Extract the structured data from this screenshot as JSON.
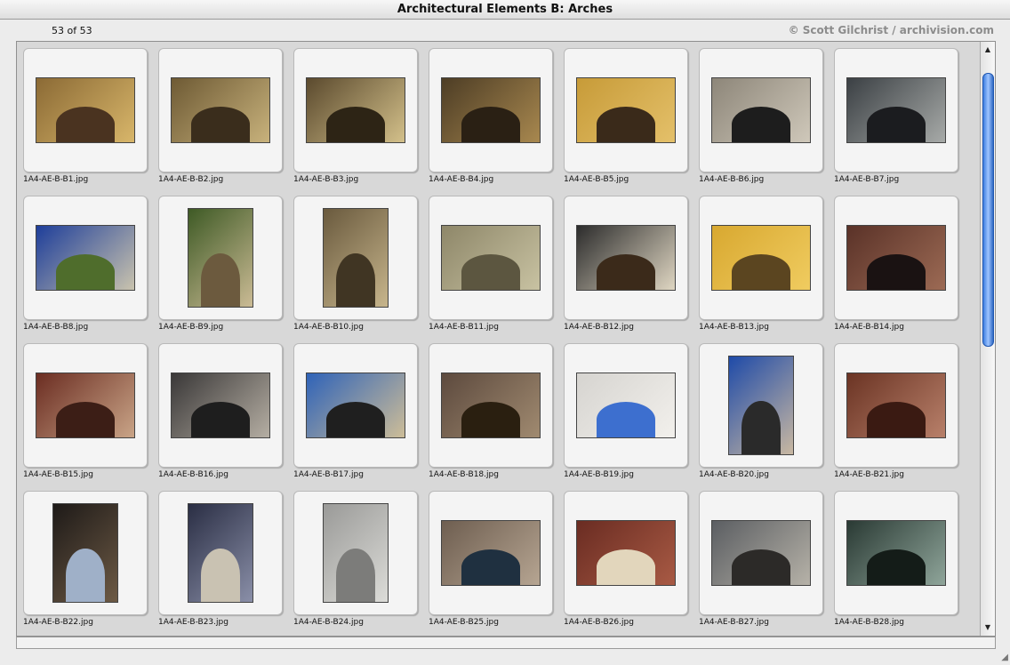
{
  "window": {
    "title": "Architectural Elements B: Arches",
    "counter": "53 of 53",
    "copyright": "© Scott Gilchrist / archivision.com"
  },
  "grid": {
    "items": [
      {
        "label": "1A4-AE-B-B1.jpg",
        "w": 110,
        "h": 72,
        "c1": "#8b6a35",
        "c2": "#d8b66a",
        "arch": "#4a3320"
      },
      {
        "label": "1A4-AE-B-B2.jpg",
        "w": 110,
        "h": 72,
        "c1": "#6e5a34",
        "c2": "#c8b27c",
        "arch": "#3a2d1c"
      },
      {
        "label": "1A4-AE-B-B3.jpg",
        "w": 110,
        "h": 72,
        "c1": "#5b4a2e",
        "c2": "#d3c08a",
        "arch": "#2d2415"
      },
      {
        "label": "1A4-AE-B-B4.jpg",
        "w": 110,
        "h": 72,
        "c1": "#4d3d25",
        "c2": "#a8884f",
        "arch": "#2a2014"
      },
      {
        "label": "1A4-AE-B-B5.jpg",
        "w": 110,
        "h": 72,
        "c1": "#c79b38",
        "c2": "#e4c06a",
        "arch": "#3a2a1a"
      },
      {
        "label": "1A4-AE-B-B6.jpg",
        "w": 110,
        "h": 72,
        "c1": "#8d8679",
        "c2": "#cfc8ba",
        "arch": "#1d1d1d"
      },
      {
        "label": "1A4-AE-B-B7.jpg",
        "w": 110,
        "h": 72,
        "c1": "#3b4044",
        "c2": "#a7aaa8",
        "arch": "#1b1c1f"
      },
      {
        "label": "1A4-AE-B-B8.jpg",
        "w": 110,
        "h": 72,
        "c1": "#1e3e9a",
        "c2": "#c9c3ae",
        "arch": "#4f6d2c"
      },
      {
        "label": "1A4-AE-B-B9.jpg",
        "w": 72,
        "h": 110,
        "c1": "#3e5a25",
        "c2": "#cbbb95",
        "arch": "#6c5a3e"
      },
      {
        "label": "1A4-AE-B-B10.jpg",
        "w": 72,
        "h": 110,
        "c1": "#6a5a3e",
        "c2": "#c7b58c",
        "arch": "#403523"
      },
      {
        "label": "1A4-AE-B-B11.jpg",
        "w": 110,
        "h": 72,
        "c1": "#8e8769",
        "c2": "#c8c2a2",
        "arch": "#5c5640"
      },
      {
        "label": "1A4-AE-B-B12.jpg",
        "w": 110,
        "h": 72,
        "c1": "#2c2c2c",
        "c2": "#dfd6c2",
        "arch": "#3b2a1a"
      },
      {
        "label": "1A4-AE-B-B13.jpg",
        "w": 110,
        "h": 72,
        "c1": "#d8a830",
        "c2": "#f0cc60",
        "arch": "#5b4520"
      },
      {
        "label": "1A4-AE-B-B14.jpg",
        "w": 110,
        "h": 72,
        "c1": "#5a3228",
        "c2": "#9c6a54",
        "arch": "#1a1212"
      },
      {
        "label": "1A4-AE-B-B15.jpg",
        "w": 110,
        "h": 72,
        "c1": "#6b2d22",
        "c2": "#c9a487",
        "arch": "#3c1e16"
      },
      {
        "label": "1A4-AE-B-B16.jpg",
        "w": 110,
        "h": 72,
        "c1": "#3a3838",
        "c2": "#b5aea3",
        "arch": "#1e1e1e"
      },
      {
        "label": "1A4-AE-B-B17.jpg",
        "w": 110,
        "h": 72,
        "c1": "#2f63b8",
        "c2": "#cdbd98",
        "arch": "#1f1f1f"
      },
      {
        "label": "1A4-AE-B-B18.jpg",
        "w": 110,
        "h": 72,
        "c1": "#5d4a3e",
        "c2": "#a08a70",
        "arch": "#2a1f10"
      },
      {
        "label": "1A4-AE-B-B19.jpg",
        "w": 110,
        "h": 72,
        "c1": "#d6d4d0",
        "c2": "#f2f0ec",
        "arch": "#3d6fcf"
      },
      {
        "label": "1A4-AE-B-B20.jpg",
        "w": 72,
        "h": 110,
        "c1": "#1e4aa8",
        "c2": "#c9b8a2",
        "arch": "#2a2a2a"
      },
      {
        "label": "1A4-AE-B-B21.jpg",
        "w": 110,
        "h": 72,
        "c1": "#6b3424",
        "c2": "#b8806a",
        "arch": "#3a1a12"
      },
      {
        "label": "1A4-AE-B-B22.jpg",
        "w": 72,
        "h": 110,
        "c1": "#1e1a18",
        "c2": "#6d5a45",
        "arch": "#9fb0c8"
      },
      {
        "label": "1A4-AE-B-B23.jpg",
        "w": 72,
        "h": 110,
        "c1": "#2a2e44",
        "c2": "#8a8fa8",
        "arch": "#c9c2b2"
      },
      {
        "label": "1A4-AE-B-B24.jpg",
        "w": 72,
        "h": 110,
        "c1": "#9a9a98",
        "c2": "#dcdcd8",
        "arch": "#7c7c7a"
      },
      {
        "label": "1A4-AE-B-B25.jpg",
        "w": 110,
        "h": 72,
        "c1": "#6e5e50",
        "c2": "#b6a592",
        "arch": "#1f3040"
      },
      {
        "label": "1A4-AE-B-B26.jpg",
        "w": 110,
        "h": 72,
        "c1": "#6a2c22",
        "c2": "#a85a44",
        "arch": "#e2d6bc"
      },
      {
        "label": "1A4-AE-B-B27.jpg",
        "w": 110,
        "h": 72,
        "c1": "#5b5e62",
        "c2": "#b6b2a8",
        "arch": "#2c2a28"
      },
      {
        "label": "1A4-AE-B-B28.jpg",
        "w": 110,
        "h": 72,
        "c1": "#2a3a34",
        "c2": "#8fa59a",
        "arch": "#141c18"
      }
    ]
  },
  "scrollbar": {
    "up_icon": "arrow-up-icon",
    "down_icon": "arrow-down-icon"
  }
}
